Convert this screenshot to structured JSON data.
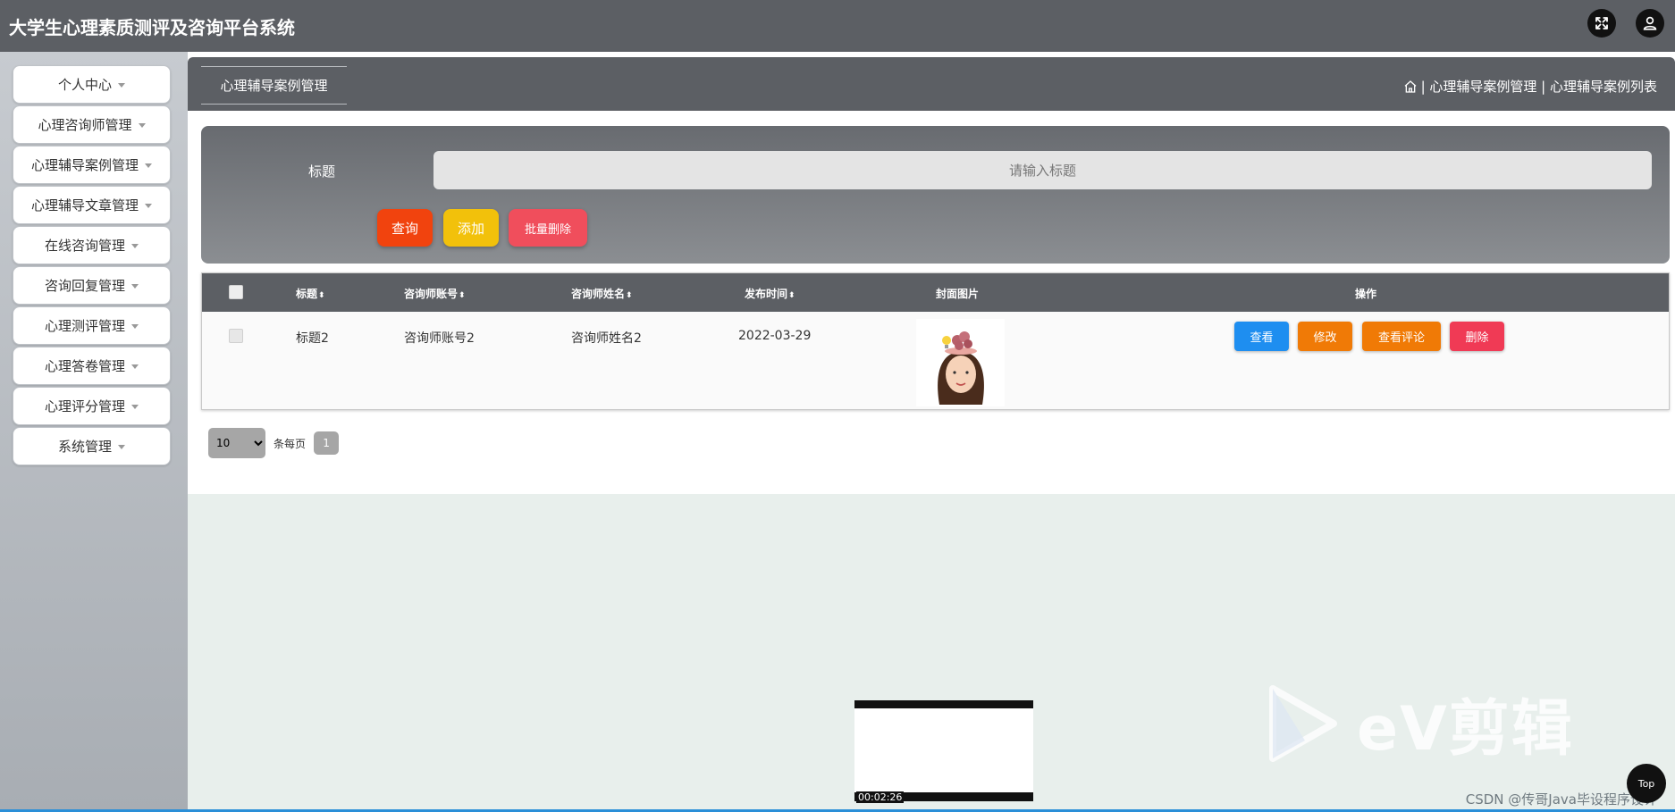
{
  "header": {
    "title": "大学生心理素质测评及咨询平台系统",
    "fullscreen_icon": "fullscreen-icon",
    "user_icon": "user-icon"
  },
  "sidebar": {
    "items": [
      {
        "label": "个人中心"
      },
      {
        "label": "心理咨询师管理"
      },
      {
        "label": "心理辅导案例管理"
      },
      {
        "label": "心理辅导文章管理"
      },
      {
        "label": "在线咨询管理"
      },
      {
        "label": "咨询回复管理"
      },
      {
        "label": "心理测评管理"
      },
      {
        "label": "心理答卷管理"
      },
      {
        "label": "心理评分管理"
      },
      {
        "label": "系统管理"
      }
    ]
  },
  "page": {
    "tab_label": "心理辅导案例管理",
    "breadcrumb": {
      "home_icon": "home-icon",
      "text": "| 心理辅导案例管理 | 心理辅导案例列表"
    }
  },
  "search": {
    "label": "标题",
    "placeholder": "请输入标题",
    "value": "",
    "query_label": "查询",
    "add_label": "添加",
    "batch_delete_label": "批量删除"
  },
  "table": {
    "columns": {
      "title": "标题",
      "account": "咨询师账号",
      "name": "咨询师姓名",
      "date": "发布时间",
      "cover": "封面图片",
      "actions": "操作"
    },
    "sort_icon": "⬍",
    "rows": [
      {
        "title": "标题2",
        "account": "咨询师账号2",
        "name": "咨询师姓名2",
        "date": "2022-03-29"
      }
    ],
    "actions": {
      "view": "查看",
      "edit": "修改",
      "review": "查看评论",
      "delete": "删除"
    }
  },
  "pagination": {
    "page_size": "10",
    "page_size_label": "条每页",
    "current_page": "1"
  },
  "overlay": {
    "video_time": "00:02:26",
    "ev_text": "eV剪辑",
    "watermark": "CSDN @传哥Java毕设程序设计",
    "top_label": "Top"
  },
  "colors": {
    "header_bg": "#5c5f64",
    "query": "#f1430e",
    "add": "#f2c10b",
    "batch_delete": "#f04e5c",
    "view": "#1e8ef0",
    "edit": "#f07a06",
    "delete": "#f03a55"
  }
}
